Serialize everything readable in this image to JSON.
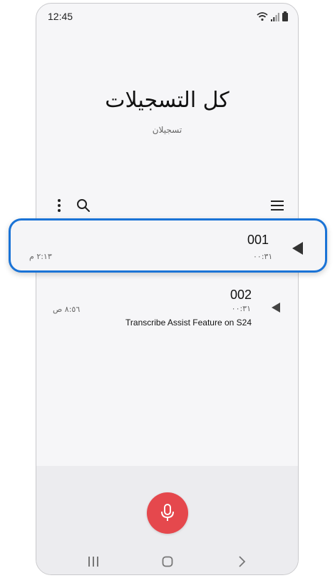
{
  "status_bar": {
    "time": "12:45"
  },
  "header": {
    "title": "كل التسجيلات",
    "subtitle": "تسجيلان"
  },
  "recordings": [
    {
      "title": "001",
      "duration": "٠٠:٣١",
      "date": "٢:١٣ م",
      "description": ""
    },
    {
      "title": "002",
      "duration": "٠٠:٣١",
      "date": "٨:٥٦ ص",
      "description": "Transcribe Assist Feature on S24"
    }
  ],
  "colors": {
    "accent": "#1a73d6",
    "record": "#e5484d"
  },
  "icons": [
    "more-options-icon",
    "search-icon",
    "menu-icon",
    "play-icon",
    "microphone-icon",
    "recent-apps-icon",
    "home-icon",
    "back-icon"
  ]
}
